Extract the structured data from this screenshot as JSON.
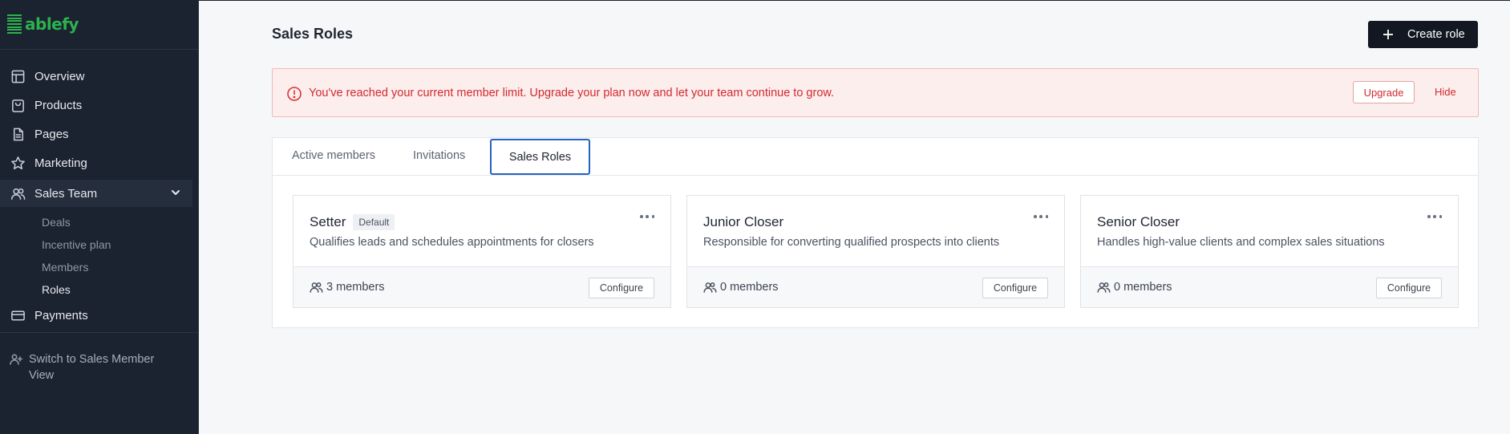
{
  "app": {
    "brand": "ablefy",
    "brand_color": "#2bb24c"
  },
  "sidebar": {
    "items": [
      {
        "label": "Overview",
        "icon": "layout-icon"
      },
      {
        "label": "Products",
        "icon": "bag-icon"
      },
      {
        "label": "Pages",
        "icon": "document-icon"
      },
      {
        "label": "Marketing",
        "icon": "star-icon"
      },
      {
        "label": "Sales Team",
        "icon": "users-icon",
        "expanded": true
      },
      {
        "label": "Payments",
        "icon": "card-icon"
      }
    ],
    "sales_team_sub": [
      {
        "label": "Deals"
      },
      {
        "label": "Incentive plan"
      },
      {
        "label": "Members"
      },
      {
        "label": "Roles",
        "current": true
      }
    ],
    "switch_view": "Switch to Sales Member View"
  },
  "header": {
    "title": "Sales Roles",
    "create_button": "Create role"
  },
  "alert": {
    "message": "You've reached your current member limit. Upgrade your plan now and let your team continue to grow.",
    "upgrade_label": "Upgrade",
    "hide_label": "Hide",
    "color": "#d12a2e"
  },
  "tabs": [
    {
      "label": "Active members"
    },
    {
      "label": "Invitations"
    },
    {
      "label": "Sales Roles",
      "active": true
    }
  ],
  "roles": [
    {
      "name": "Setter",
      "badge": "Default",
      "description": "Qualifies leads and schedules appointments for closers",
      "members": "3 members",
      "configure": "Configure"
    },
    {
      "name": "Junior Closer",
      "badge": "",
      "description": "Responsible for converting qualified prospects into clients",
      "members": "0 members",
      "configure": "Configure"
    },
    {
      "name": "Senior Closer",
      "badge": "",
      "description": "Handles high-value clients and complex sales situations",
      "members": "0 members",
      "configure": "Configure"
    }
  ]
}
